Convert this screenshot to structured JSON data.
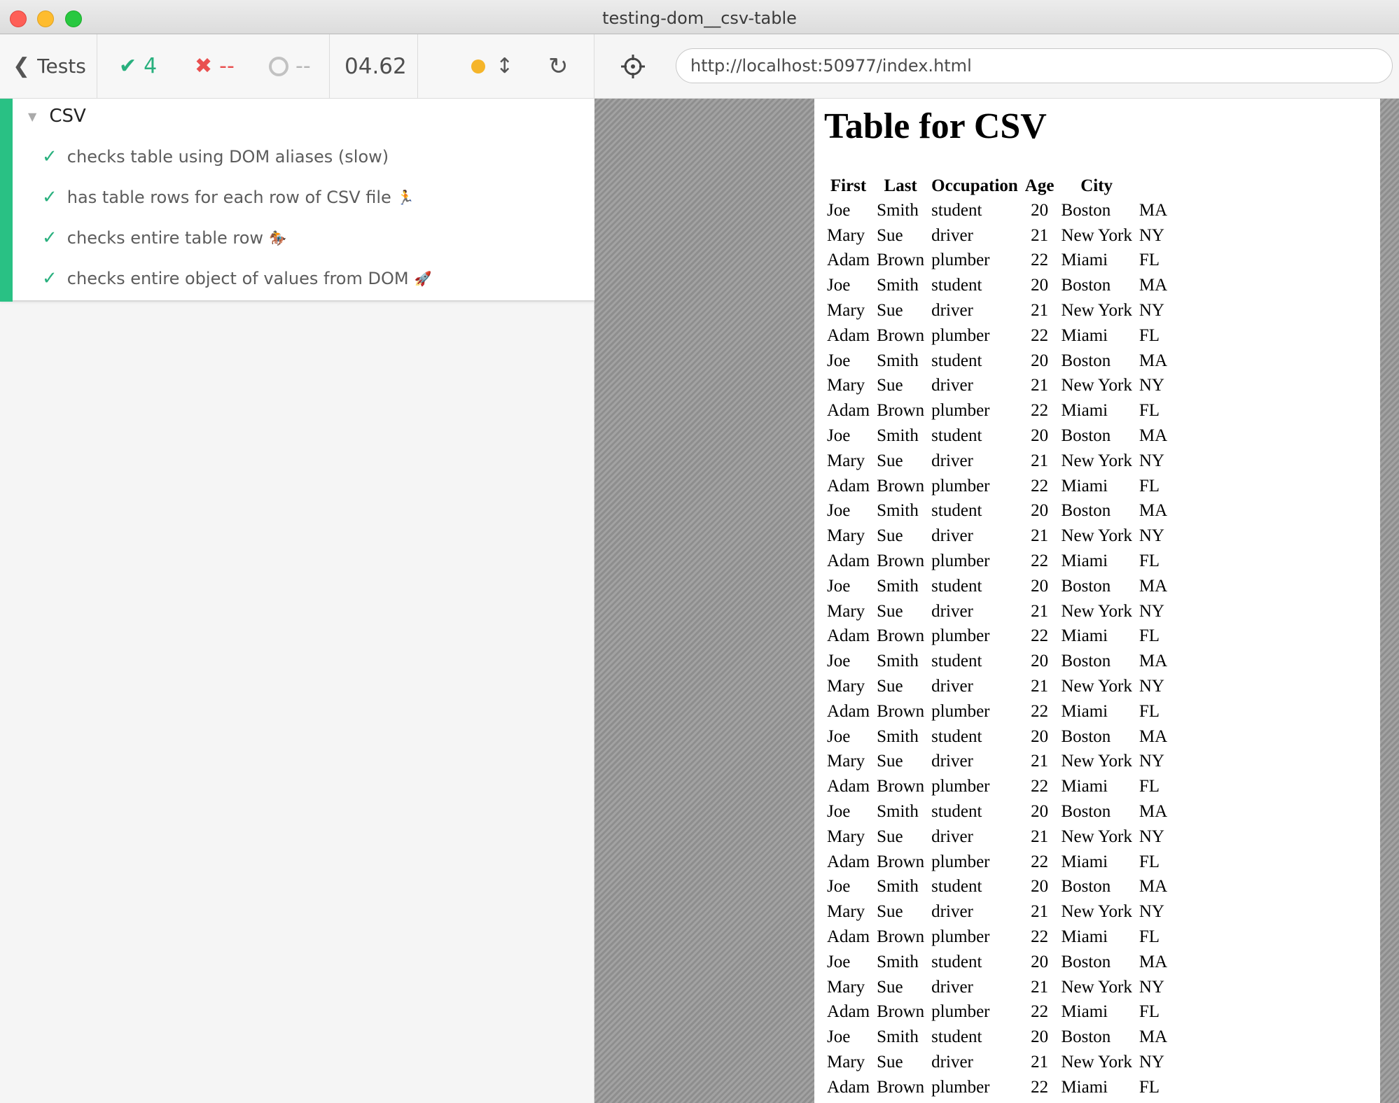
{
  "window": {
    "title": "testing-dom__csv-table"
  },
  "header": {
    "tests_label": "Tests",
    "passed_count": "4",
    "failed_count": "--",
    "pending_count": "--",
    "duration": "04.62",
    "status_color": "#f5b52a"
  },
  "aut": {
    "url": "http://localhost:50977/index.html"
  },
  "suite": {
    "title": "CSV",
    "tests": [
      {
        "label": "checks table using DOM aliases (slow)",
        "emoji": ""
      },
      {
        "label": "has table rows for each row of CSV file",
        "emoji": "🏃"
      },
      {
        "label": "checks entire table row",
        "emoji": "🏇"
      },
      {
        "label": "checks entire object of values from DOM",
        "emoji": "🚀"
      }
    ]
  },
  "page": {
    "heading": "Table for CSV",
    "columns": [
      "First",
      "Last",
      "Occupation",
      "Age",
      "City",
      ""
    ],
    "rows": [
      [
        "Joe",
        "Smith",
        "student",
        "20",
        "Boston",
        "MA"
      ],
      [
        "Mary",
        "Sue",
        "driver",
        "21",
        "New York",
        "NY"
      ],
      [
        "Adam",
        "Brown",
        "plumber",
        "22",
        "Miami",
        "FL"
      ],
      [
        "Joe",
        "Smith",
        "student",
        "20",
        "Boston",
        "MA"
      ],
      [
        "Mary",
        "Sue",
        "driver",
        "21",
        "New York",
        "NY"
      ],
      [
        "Adam",
        "Brown",
        "plumber",
        "22",
        "Miami",
        "FL"
      ],
      [
        "Joe",
        "Smith",
        "student",
        "20",
        "Boston",
        "MA"
      ],
      [
        "Mary",
        "Sue",
        "driver",
        "21",
        "New York",
        "NY"
      ],
      [
        "Adam",
        "Brown",
        "plumber",
        "22",
        "Miami",
        "FL"
      ],
      [
        "Joe",
        "Smith",
        "student",
        "20",
        "Boston",
        "MA"
      ],
      [
        "Mary",
        "Sue",
        "driver",
        "21",
        "New York",
        "NY"
      ],
      [
        "Adam",
        "Brown",
        "plumber",
        "22",
        "Miami",
        "FL"
      ],
      [
        "Joe",
        "Smith",
        "student",
        "20",
        "Boston",
        "MA"
      ],
      [
        "Mary",
        "Sue",
        "driver",
        "21",
        "New York",
        "NY"
      ],
      [
        "Adam",
        "Brown",
        "plumber",
        "22",
        "Miami",
        "FL"
      ],
      [
        "Joe",
        "Smith",
        "student",
        "20",
        "Boston",
        "MA"
      ],
      [
        "Mary",
        "Sue",
        "driver",
        "21",
        "New York",
        "NY"
      ],
      [
        "Adam",
        "Brown",
        "plumber",
        "22",
        "Miami",
        "FL"
      ],
      [
        "Joe",
        "Smith",
        "student",
        "20",
        "Boston",
        "MA"
      ],
      [
        "Mary",
        "Sue",
        "driver",
        "21",
        "New York",
        "NY"
      ],
      [
        "Adam",
        "Brown",
        "plumber",
        "22",
        "Miami",
        "FL"
      ],
      [
        "Joe",
        "Smith",
        "student",
        "20",
        "Boston",
        "MA"
      ],
      [
        "Mary",
        "Sue",
        "driver",
        "21",
        "New York",
        "NY"
      ],
      [
        "Adam",
        "Brown",
        "plumber",
        "22",
        "Miami",
        "FL"
      ],
      [
        "Joe",
        "Smith",
        "student",
        "20",
        "Boston",
        "MA"
      ],
      [
        "Mary",
        "Sue",
        "driver",
        "21",
        "New York",
        "NY"
      ],
      [
        "Adam",
        "Brown",
        "plumber",
        "22",
        "Miami",
        "FL"
      ],
      [
        "Joe",
        "Smith",
        "student",
        "20",
        "Boston",
        "MA"
      ],
      [
        "Mary",
        "Sue",
        "driver",
        "21",
        "New York",
        "NY"
      ],
      [
        "Adam",
        "Brown",
        "plumber",
        "22",
        "Miami",
        "FL"
      ],
      [
        "Joe",
        "Smith",
        "student",
        "20",
        "Boston",
        "MA"
      ],
      [
        "Mary",
        "Sue",
        "driver",
        "21",
        "New York",
        "NY"
      ],
      [
        "Adam",
        "Brown",
        "plumber",
        "22",
        "Miami",
        "FL"
      ],
      [
        "Joe",
        "Smith",
        "student",
        "20",
        "Boston",
        "MA"
      ],
      [
        "Mary",
        "Sue",
        "driver",
        "21",
        "New York",
        "NY"
      ],
      [
        "Adam",
        "Brown",
        "plumber",
        "22",
        "Miami",
        "FL"
      ]
    ]
  }
}
